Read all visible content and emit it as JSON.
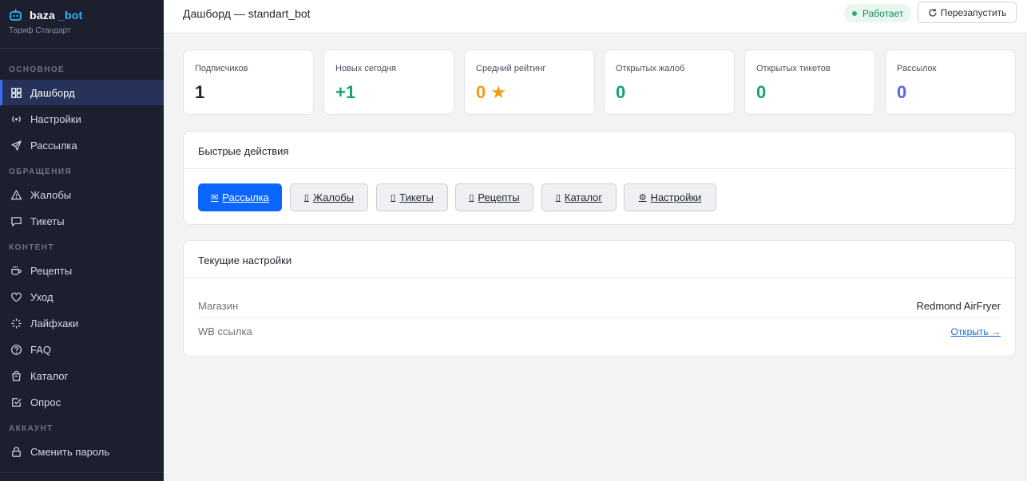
{
  "brand": {
    "name_main": "baza",
    "name_accent": "_bot",
    "plan": "Тариф Стандарт",
    "accent_color": "#35b3ff"
  },
  "sidebar": {
    "sections": {
      "main": "ОСНОВНОЕ",
      "requests": "ОБРАЩЕНИЯ",
      "content": "КОНТЕНТ",
      "account": "АККАУНТ"
    },
    "items": [
      {
        "label": "Дашборд",
        "icon": "grid-icon",
        "active": true
      },
      {
        "label": "Настройки",
        "icon": "broadcast-icon"
      },
      {
        "label": "Рассылка",
        "icon": "send-icon"
      },
      {
        "label": "Жалобы",
        "icon": "warning-icon"
      },
      {
        "label": "Тикеты",
        "icon": "chat-icon"
      },
      {
        "label": "Рецепты",
        "icon": "cup-icon"
      },
      {
        "label": "Уход",
        "icon": "heart-icon"
      },
      {
        "label": "Лайфхаки",
        "icon": "sparkle-icon"
      },
      {
        "label": "FAQ",
        "icon": "question-icon"
      },
      {
        "label": "Каталог",
        "icon": "bag-icon"
      },
      {
        "label": "Опрос",
        "icon": "checkbox-icon"
      },
      {
        "label": "Сменить пароль",
        "icon": "lock-icon"
      }
    ]
  },
  "header": {
    "title": "Дашборд — standart_bot",
    "status": "Работает",
    "status_color": "#22b36b",
    "restart_label": "Перезапустить",
    "restart_icon": "refresh-icon"
  },
  "stats": [
    {
      "label": "Подписчиков",
      "value": "1",
      "color": "#1f2330"
    },
    {
      "label": "Новых сегодня",
      "value": "+1",
      "color": "#16a37a"
    },
    {
      "label": "Средний рейтинг",
      "value": "0 ★",
      "color": "#f29d12"
    },
    {
      "label": "Открытых жалоб",
      "value": "0",
      "color": "#16a37a"
    },
    {
      "label": "Открытых тикетов",
      "value": "0",
      "color": "#16a37a"
    },
    {
      "label": "Рассылок",
      "value": "0",
      "color": "#5b63e8"
    }
  ],
  "quick_actions": {
    "title": "Быстрые действия",
    "buttons": [
      {
        "glyph": "✉",
        "label": "Рассылка",
        "icon": "envelope-icon"
      },
      {
        "glyph": "▯",
        "label": "Жалобы",
        "icon": "placeholder-icon"
      },
      {
        "glyph": "▯",
        "label": "Тикеты",
        "icon": "placeholder-icon"
      },
      {
        "glyph": "▯",
        "label": "Рецепты",
        "icon": "placeholder-icon"
      },
      {
        "glyph": "▯",
        "label": "Каталог",
        "icon": "placeholder-icon"
      },
      {
        "glyph": "⚙",
        "label": "Настройки",
        "icon": "gear-icon"
      }
    ]
  },
  "settings": {
    "title": "Текущие настройки",
    "rows": [
      {
        "label": "Магазин",
        "value": "Redmond AirFryer"
      },
      {
        "label": "WB ссылка",
        "value": "Открыть →"
      }
    ]
  }
}
